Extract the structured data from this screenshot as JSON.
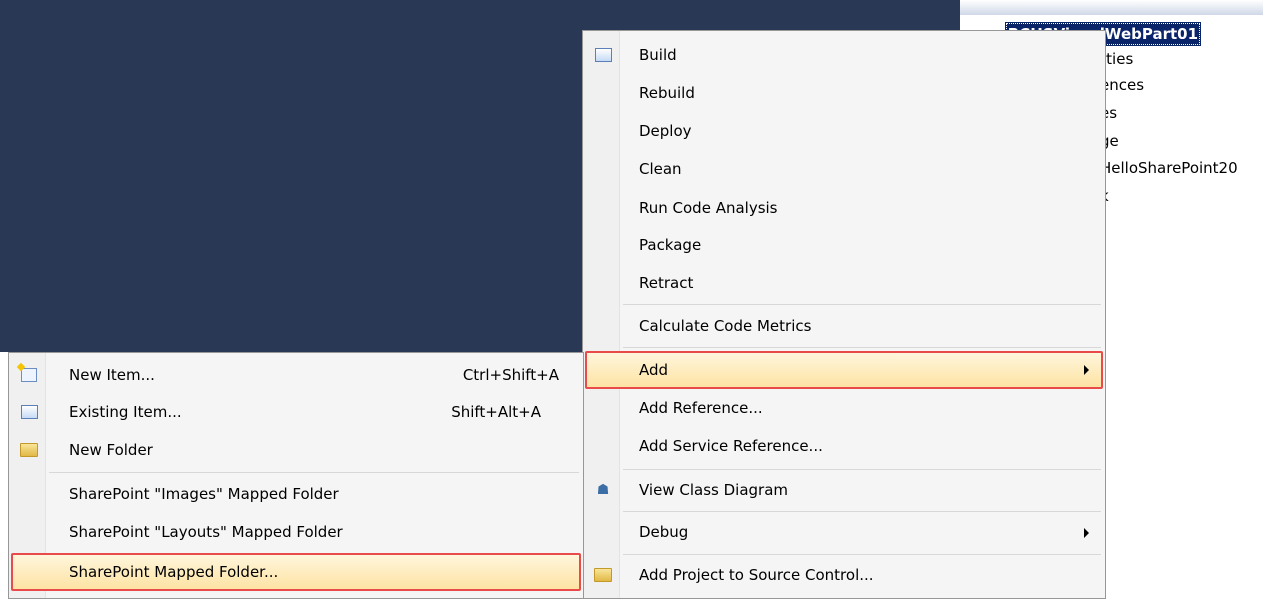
{
  "solution_explorer": {
    "project_name": "BCHSVisualWebPart01",
    "project_icon": "csharp-project-icon",
    "items": [
      "rties",
      "ences",
      "es",
      "ge",
      "HelloSharePoint20",
      "k"
    ]
  },
  "project_menu": {
    "items": [
      {
        "label": "Build",
        "icon": "build-icon"
      },
      {
        "label": "Rebuild"
      },
      {
        "label": "Deploy"
      },
      {
        "label": "Clean"
      },
      {
        "label": "Run Code Analysis"
      },
      {
        "label": "Package"
      },
      {
        "label": "Retract"
      },
      {
        "label": "Calculate Code Metrics"
      },
      {
        "label": "Add",
        "submenu": true,
        "highlighted": true
      },
      {
        "label": "Add Reference..."
      },
      {
        "label": "Add Service Reference..."
      },
      {
        "label": "View Class Diagram",
        "icon": "class-diagram-icon"
      },
      {
        "label": "Debug",
        "submenu": true
      },
      {
        "label": "Add Project to Source Control...",
        "icon": "source-control-icon"
      }
    ]
  },
  "add_submenu": {
    "items": [
      {
        "label": "New Item...",
        "shortcut": "Ctrl+Shift+A",
        "icon": "new-item-icon"
      },
      {
        "label": "Existing Item...",
        "shortcut": "Shift+Alt+A",
        "icon": "existing-item-icon"
      },
      {
        "label": "New Folder",
        "icon": "new-folder-icon"
      },
      {
        "label": "SharePoint \"Images\" Mapped Folder"
      },
      {
        "label": "SharePoint \"Layouts\" Mapped Folder"
      },
      {
        "label": "SharePoint Mapped Folder...",
        "highlighted": true
      }
    ]
  },
  "colors": {
    "background_dark": "#293955",
    "highlight_border": "#e94a4a",
    "selection": "#0a246a"
  }
}
